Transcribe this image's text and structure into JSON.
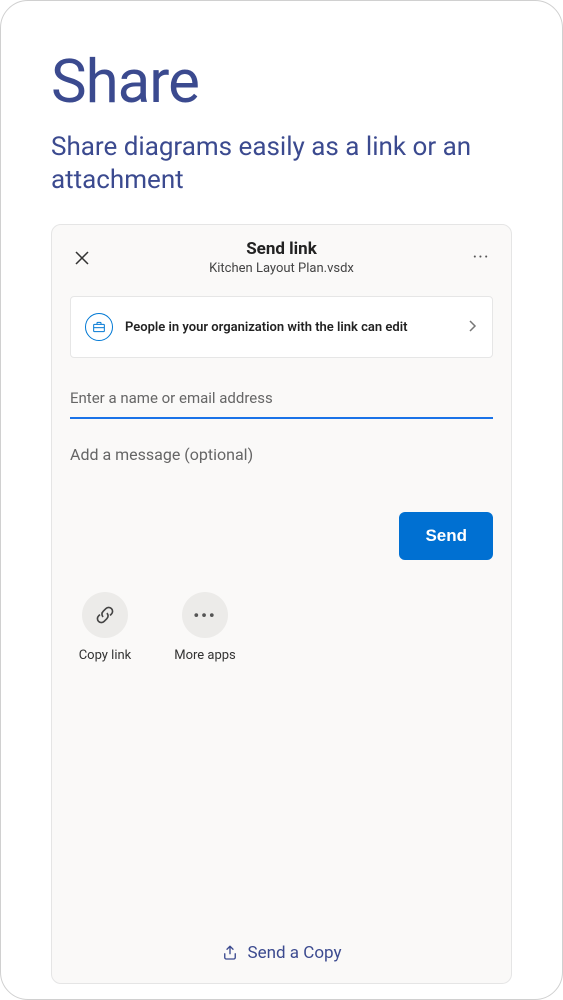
{
  "hero": {
    "title": "Share",
    "subtitle": "Share diagrams easily as a link or an attachment"
  },
  "sheet": {
    "title": "Send link",
    "filename": "Kitchen Layout Plan.vsdx",
    "permission_text": "People in your organization with the link can edit",
    "name_placeholder": "Enter a name or email address",
    "message_placeholder": "Add a message (optional)",
    "send_label": "Send",
    "actions": {
      "copy_link": "Copy link",
      "more_apps": "More apps"
    },
    "footer_label": "Send a Copy"
  }
}
